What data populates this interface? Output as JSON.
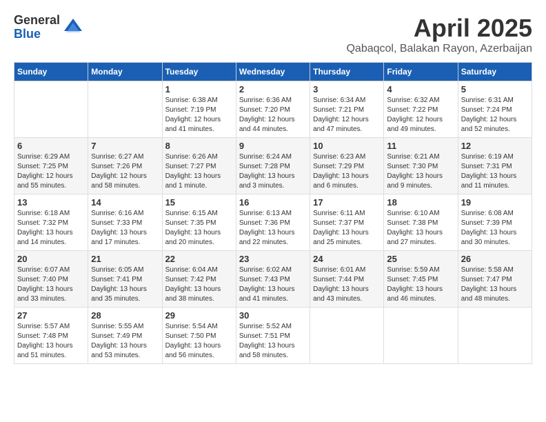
{
  "logo": {
    "general": "General",
    "blue": "Blue"
  },
  "title": "April 2025",
  "location": "Qabaqcol, Balakan Rayon, Azerbaijan",
  "weekdays": [
    "Sunday",
    "Monday",
    "Tuesday",
    "Wednesday",
    "Thursday",
    "Friday",
    "Saturday"
  ],
  "weeks": [
    [
      {
        "day": "",
        "sunrise": "",
        "sunset": "",
        "daylight": ""
      },
      {
        "day": "",
        "sunrise": "",
        "sunset": "",
        "daylight": ""
      },
      {
        "day": "1",
        "sunrise": "Sunrise: 6:38 AM",
        "sunset": "Sunset: 7:19 PM",
        "daylight": "Daylight: 12 hours and 41 minutes."
      },
      {
        "day": "2",
        "sunrise": "Sunrise: 6:36 AM",
        "sunset": "Sunset: 7:20 PM",
        "daylight": "Daylight: 12 hours and 44 minutes."
      },
      {
        "day": "3",
        "sunrise": "Sunrise: 6:34 AM",
        "sunset": "Sunset: 7:21 PM",
        "daylight": "Daylight: 12 hours and 47 minutes."
      },
      {
        "day": "4",
        "sunrise": "Sunrise: 6:32 AM",
        "sunset": "Sunset: 7:22 PM",
        "daylight": "Daylight: 12 hours and 49 minutes."
      },
      {
        "day": "5",
        "sunrise": "Sunrise: 6:31 AM",
        "sunset": "Sunset: 7:24 PM",
        "daylight": "Daylight: 12 hours and 52 minutes."
      }
    ],
    [
      {
        "day": "6",
        "sunrise": "Sunrise: 6:29 AM",
        "sunset": "Sunset: 7:25 PM",
        "daylight": "Daylight: 12 hours and 55 minutes."
      },
      {
        "day": "7",
        "sunrise": "Sunrise: 6:27 AM",
        "sunset": "Sunset: 7:26 PM",
        "daylight": "Daylight: 12 hours and 58 minutes."
      },
      {
        "day": "8",
        "sunrise": "Sunrise: 6:26 AM",
        "sunset": "Sunset: 7:27 PM",
        "daylight": "Daylight: 13 hours and 1 minute."
      },
      {
        "day": "9",
        "sunrise": "Sunrise: 6:24 AM",
        "sunset": "Sunset: 7:28 PM",
        "daylight": "Daylight: 13 hours and 3 minutes."
      },
      {
        "day": "10",
        "sunrise": "Sunrise: 6:23 AM",
        "sunset": "Sunset: 7:29 PM",
        "daylight": "Daylight: 13 hours and 6 minutes."
      },
      {
        "day": "11",
        "sunrise": "Sunrise: 6:21 AM",
        "sunset": "Sunset: 7:30 PM",
        "daylight": "Daylight: 13 hours and 9 minutes."
      },
      {
        "day": "12",
        "sunrise": "Sunrise: 6:19 AM",
        "sunset": "Sunset: 7:31 PM",
        "daylight": "Daylight: 13 hours and 11 minutes."
      }
    ],
    [
      {
        "day": "13",
        "sunrise": "Sunrise: 6:18 AM",
        "sunset": "Sunset: 7:32 PM",
        "daylight": "Daylight: 13 hours and 14 minutes."
      },
      {
        "day": "14",
        "sunrise": "Sunrise: 6:16 AM",
        "sunset": "Sunset: 7:33 PM",
        "daylight": "Daylight: 13 hours and 17 minutes."
      },
      {
        "day": "15",
        "sunrise": "Sunrise: 6:15 AM",
        "sunset": "Sunset: 7:35 PM",
        "daylight": "Daylight: 13 hours and 20 minutes."
      },
      {
        "day": "16",
        "sunrise": "Sunrise: 6:13 AM",
        "sunset": "Sunset: 7:36 PM",
        "daylight": "Daylight: 13 hours and 22 minutes."
      },
      {
        "day": "17",
        "sunrise": "Sunrise: 6:11 AM",
        "sunset": "Sunset: 7:37 PM",
        "daylight": "Daylight: 13 hours and 25 minutes."
      },
      {
        "day": "18",
        "sunrise": "Sunrise: 6:10 AM",
        "sunset": "Sunset: 7:38 PM",
        "daylight": "Daylight: 13 hours and 27 minutes."
      },
      {
        "day": "19",
        "sunrise": "Sunrise: 6:08 AM",
        "sunset": "Sunset: 7:39 PM",
        "daylight": "Daylight: 13 hours and 30 minutes."
      }
    ],
    [
      {
        "day": "20",
        "sunrise": "Sunrise: 6:07 AM",
        "sunset": "Sunset: 7:40 PM",
        "daylight": "Daylight: 13 hours and 33 minutes."
      },
      {
        "day": "21",
        "sunrise": "Sunrise: 6:05 AM",
        "sunset": "Sunset: 7:41 PM",
        "daylight": "Daylight: 13 hours and 35 minutes."
      },
      {
        "day": "22",
        "sunrise": "Sunrise: 6:04 AM",
        "sunset": "Sunset: 7:42 PM",
        "daylight": "Daylight: 13 hours and 38 minutes."
      },
      {
        "day": "23",
        "sunrise": "Sunrise: 6:02 AM",
        "sunset": "Sunset: 7:43 PM",
        "daylight": "Daylight: 13 hours and 41 minutes."
      },
      {
        "day": "24",
        "sunrise": "Sunrise: 6:01 AM",
        "sunset": "Sunset: 7:44 PM",
        "daylight": "Daylight: 13 hours and 43 minutes."
      },
      {
        "day": "25",
        "sunrise": "Sunrise: 5:59 AM",
        "sunset": "Sunset: 7:45 PM",
        "daylight": "Daylight: 13 hours and 46 minutes."
      },
      {
        "day": "26",
        "sunrise": "Sunrise: 5:58 AM",
        "sunset": "Sunset: 7:47 PM",
        "daylight": "Daylight: 13 hours and 48 minutes."
      }
    ],
    [
      {
        "day": "27",
        "sunrise": "Sunrise: 5:57 AM",
        "sunset": "Sunset: 7:48 PM",
        "daylight": "Daylight: 13 hours and 51 minutes."
      },
      {
        "day": "28",
        "sunrise": "Sunrise: 5:55 AM",
        "sunset": "Sunset: 7:49 PM",
        "daylight": "Daylight: 13 hours and 53 minutes."
      },
      {
        "day": "29",
        "sunrise": "Sunrise: 5:54 AM",
        "sunset": "Sunset: 7:50 PM",
        "daylight": "Daylight: 13 hours and 56 minutes."
      },
      {
        "day": "30",
        "sunrise": "Sunrise: 5:52 AM",
        "sunset": "Sunset: 7:51 PM",
        "daylight": "Daylight: 13 hours and 58 minutes."
      },
      {
        "day": "",
        "sunrise": "",
        "sunset": "",
        "daylight": ""
      },
      {
        "day": "",
        "sunrise": "",
        "sunset": "",
        "daylight": ""
      },
      {
        "day": "",
        "sunrise": "",
        "sunset": "",
        "daylight": ""
      }
    ]
  ]
}
